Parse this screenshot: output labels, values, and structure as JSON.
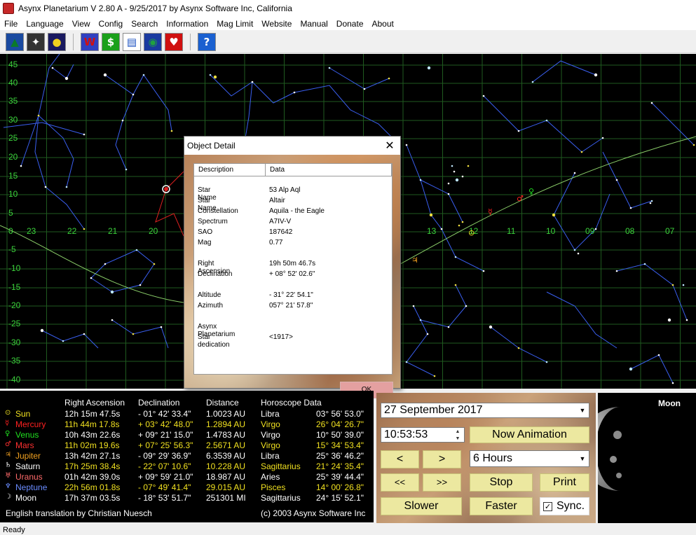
{
  "window": {
    "title": "Asynx Planetarium V 2.80 A - 9/25/2017 by Asynx Software Inc, California"
  },
  "menu": [
    "File",
    "Language",
    "View",
    "Config",
    "Search",
    "Information",
    "Mag Limit",
    "Website",
    "Manual",
    "Donate",
    "About"
  ],
  "toolbar": {
    "buttons": [
      {
        "icon": "landscape-icon",
        "glyph": "▲",
        "color": "#0a7a2a",
        "bg": "#1a4aa0"
      },
      {
        "icon": "constellation-icon",
        "glyph": "✦",
        "color": "#ffffff",
        "bg": "#333333"
      },
      {
        "icon": "planets-icon",
        "glyph": "●",
        "color": "#f0d020",
        "bg": "#1a1a60"
      },
      {
        "icon": "w-icon",
        "glyph": "W",
        "color": "#d01010",
        "bg": "#3040c0"
      },
      {
        "icon": "dollar-icon",
        "glyph": "$",
        "color": "#ffffff",
        "bg": "#1aa01a"
      },
      {
        "icon": "document-icon",
        "glyph": "▤",
        "color": "#1a50c0",
        "bg": "#ffffff"
      },
      {
        "icon": "globe-icon",
        "glyph": "◉",
        "color": "#20a040",
        "bg": "#1a3aa0"
      },
      {
        "icon": "heart-icon",
        "glyph": "♥",
        "color": "#ffffff",
        "bg": "#d01010"
      },
      {
        "icon": "help-icon",
        "glyph": "?",
        "color": "#ffffff",
        "bg": "#1a60d0"
      }
    ]
  },
  "skymap": {
    "dec_labels": [
      "45",
      "40",
      "35",
      "30",
      "25",
      "20",
      "15",
      "10",
      "5",
      "0",
      "-5",
      "-10",
      "-15",
      "-20",
      "-25",
      "-30",
      "-35",
      "-40"
    ],
    "ra_labels": [
      "23",
      "22",
      "21",
      "20",
      "13",
      "12",
      "11",
      "10",
      "09",
      "08",
      "07"
    ],
    "planet_markers": [
      {
        "name": "sun-symbol",
        "glyph": "⊙",
        "color": "#f0e020"
      },
      {
        "name": "mercury-symbol",
        "glyph": "☿",
        "color": "#ff2020"
      },
      {
        "name": "venus-symbol",
        "glyph": "♀",
        "color": "#20e020"
      },
      {
        "name": "mars-symbol",
        "glyph": "♂",
        "color": "#ff2020"
      },
      {
        "name": "jupiter-symbol",
        "glyph": "♃",
        "color": "#f0a020"
      }
    ]
  },
  "dialog": {
    "title": "Object Detail",
    "close_glyph": "✕",
    "col_description": "Description",
    "col_data": "Data",
    "rows": [
      {
        "label": "Star Name",
        "value": "53 Alp Aql"
      },
      {
        "label": "Star Name",
        "value": "Altair"
      },
      {
        "label": "Constellation",
        "value": "Aquila - the Eagle"
      },
      {
        "label": "Spectrum",
        "value": "A7IV-V"
      },
      {
        "label": "SAO",
        "value": "187642"
      },
      {
        "label": "Mag",
        "value": "0.77"
      },
      {
        "label": "Right Ascension",
        "value": "19h 50m 46.7s"
      },
      {
        "label": "Declination",
        "value": "+ 08° 52' 02.6\""
      },
      {
        "label": "Altitude",
        "value": "-  31° 22' 54.1\""
      },
      {
        "label": "Azimuth",
        "value": "057° 21' 57.8\""
      },
      {
        "label": "Asynx Planetarium",
        "value": ""
      },
      {
        "label": "Star dedication",
        "value": "<1917>"
      }
    ],
    "ok_label": "OK"
  },
  "planet_table": {
    "headers": [
      "Right Ascension",
      "Declination",
      "Distance",
      "Horoscope Data"
    ],
    "rows": [
      {
        "symbol": "⊙",
        "name": "Sun",
        "ra": "12h 15m 47.5s",
        "dec": "- 01° 42' 33.4\"",
        "dist": "1.0023 AU",
        "sign": "Libra",
        "pos": "03° 56' 53.0\"",
        "color": "#f0e020",
        "dataColor": "#ffffff"
      },
      {
        "symbol": "☿",
        "name": "Mercury",
        "ra": "11h 44m 17.8s",
        "dec": "+ 03° 42' 48.0\"",
        "dist": "1.2894 AU",
        "sign": "Virgo",
        "pos": "26° 04' 26.7\"",
        "color": "#ff2020",
        "dataColor": "#f0e020"
      },
      {
        "symbol": "♀",
        "name": "Venus",
        "ra": "10h 43m 22.6s",
        "dec": "+ 09° 21' 15.0\"",
        "dist": "1.4783 AU",
        "sign": "Virgo",
        "pos": "10° 50' 39.0\"",
        "color": "#20e020",
        "dataColor": "#ffffff"
      },
      {
        "symbol": "♂",
        "name": "Mars",
        "ra": "11h 02m 19.6s",
        "dec": "+ 07° 25' 56.3\"",
        "dist": "2.5671 AU",
        "sign": "Virgo",
        "pos": "15° 34' 53.4\"",
        "color": "#ff3030",
        "dataColor": "#f0e020"
      },
      {
        "symbol": "♃",
        "name": "Jupiter",
        "ra": "13h 42m 27.1s",
        "dec": "- 09° 29' 36.9\"",
        "dist": "6.3539 AU",
        "sign": "Libra",
        "pos": "25° 36' 46.2\"",
        "color": "#f0a020",
        "dataColor": "#ffffff"
      },
      {
        "symbol": "♄",
        "name": "Saturn",
        "ra": "17h 25m 38.4s",
        "dec": "- 22° 07' 10.6\"",
        "dist": "10.228 AU",
        "sign": "Sagittarius",
        "pos": "21° 24' 35.4\"",
        "color": "#ffffff",
        "dataColor": "#f0e020"
      },
      {
        "symbol": "♅",
        "name": "Uranus",
        "ra": "01h 42m 39.0s",
        "dec": "+ 09° 59' 21.0\"",
        "dist": "18.987 AU",
        "sign": "Aries",
        "pos": "25° 39' 44.4\"",
        "color": "#ff6a6a",
        "dataColor": "#ffffff"
      },
      {
        "symbol": "♆",
        "name": "Neptune",
        "ra": "22h 56m 01.8s",
        "dec": "- 07° 49' 41.4\"",
        "dist": "29.015 AU",
        "sign": "Pisces",
        "pos": "14° 00' 26.8\"",
        "color": "#6a8cff",
        "dataColor": "#f0e020"
      },
      {
        "symbol": "☽",
        "name": "Moon",
        "ra": "17h 37m 03.5s",
        "dec": "- 18° 53' 51.7\"",
        "dist": "251301 MI",
        "sign": "Sagittarius",
        "pos": "24° 15' 52.1\"",
        "color": "#ffffff",
        "dataColor": "#ffffff"
      }
    ],
    "footer_left": "English translation by Christian Nuesch",
    "footer_right": "(c) 2003 Asynx Software Inc"
  },
  "controls": {
    "date_value": "27 September 2017",
    "time_value": "10:53:53",
    "now_animation": "Now Animation",
    "prev": "<",
    "next": ">",
    "interval_value": "6 Hours",
    "fast_prev": "<<",
    "fast_next": ">>",
    "stop": "Stop",
    "print": "Print",
    "slower": "Slower",
    "faster": "Faster",
    "sync_label": "Sync.",
    "sync_checked": "✓"
  },
  "moon": {
    "title": "Moon"
  },
  "status": "Ready"
}
